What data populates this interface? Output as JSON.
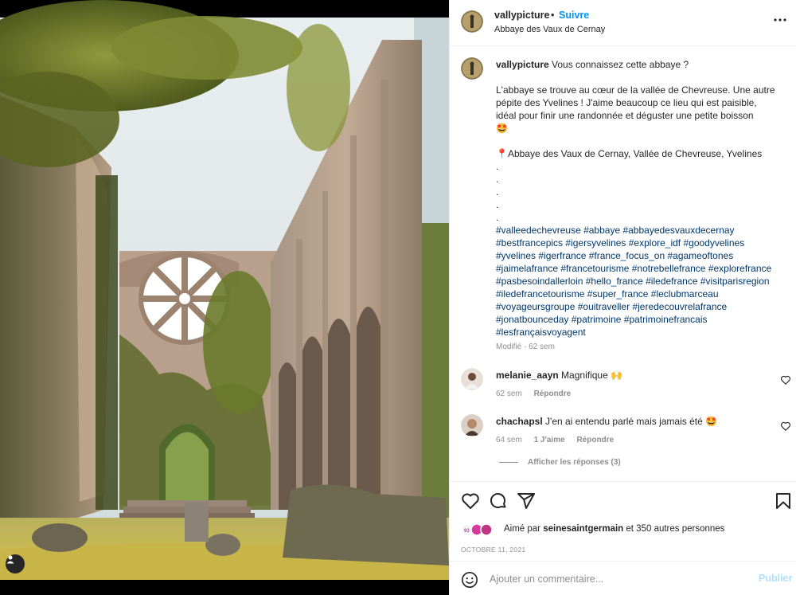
{
  "post": {
    "username": "vallypicture",
    "follow_separator": "•",
    "follow_label": "Suivre",
    "location": "Abbaye des Vaux de Cernay",
    "more_icon": "more-horizontal-icon"
  },
  "caption": {
    "username": "vallypicture",
    "intro": " Vous connaissez cette abbaye ?",
    "paragraph": "L'abbaye se trouve au cœur de la vallée de Chevreuse. Une autre pépite des Yvelines ! J'aime beaucoup ce lieu qui est paisible, idéal pour finir une randonnée et déguster une petite boisson",
    "paragraph_emoji": "🤩",
    "location_line": "📍Abbaye des Vaux de Cernay, Vallée de Chevreuse, Yvelines",
    "dots": ".\n.\n.\n.\n.",
    "hashtags": "#valleedechevreuse #abbaye #abbayedesvauxdecernay #bestfrancepics #igersyvelines #explore_idf #goodyvelines #yvelines #igerfrance #france_focus_on #agameoftones #jaimelafrance #francetourisme #notrebellefrance #explorefrance #pasbesoindallerloin #hello_france #iledefrance #visitparisregion #iledefrancetourisme #super_france #leclubmarceau #voyageursgroupe #ouitraveller #jeredecouvrelafrance #jonatbounceday #patrimoine #patrimoinefrancais #lesfrançaisvoyagent",
    "edited": "Modifié · 62 sem"
  },
  "comments": [
    {
      "username": "melanie_aayn",
      "text": " Magnifique 🙌",
      "time": "62 sem",
      "likes": "",
      "reply": "Répondre"
    },
    {
      "username": "chachapsl",
      "text": " J'en ai entendu parlé mais jamais été 🤩",
      "time": "64 sem",
      "likes": "1 J'aime",
      "reply": "Répondre"
    }
  ],
  "view_replies": "Afficher les réponses (3)",
  "actions": {
    "like_icon": "heart-icon",
    "comment_icon": "comment-icon",
    "share_icon": "share-icon",
    "save_icon": "bookmark-icon"
  },
  "likes": {
    "prefix": "Aimé par ",
    "user": "seinesaintgermain",
    "suffix": " et 350 autres personnes"
  },
  "date": "OCTOBRE 11, 2021",
  "add_comment": {
    "placeholder": "Ajouter un commentaire...",
    "publish_label": "Publier",
    "emoji_icon": "smiley-icon"
  },
  "colors": {
    "accent": "#0095f6",
    "link": "#00376b",
    "muted": "#8e8e8e",
    "publish_disabled": "#b2dffc"
  }
}
